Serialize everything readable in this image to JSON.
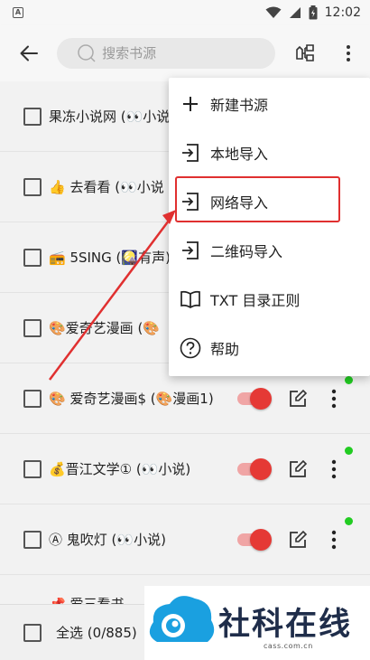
{
  "status_bar": {
    "notification_letter": "A",
    "time": "12:02",
    "icons": [
      "wifi-icon",
      "signal-icon",
      "battery-icon"
    ]
  },
  "toolbar": {
    "back_icon": "arrow-left-icon",
    "search_placeholder": "搜索书源",
    "group_icon": "group-icon",
    "more_icon": "more-vert-icon"
  },
  "list": {
    "items": [
      {
        "name": "果冻小说网 (👀小说"
      },
      {
        "name": "👍 去看看 (👀小说"
      },
      {
        "name": "📻 5SING (🎑有声)"
      },
      {
        "name": "🎨爱奇艺漫画 (🎨"
      },
      {
        "name": "🎨 爱奇艺漫画$ (🎨漫画1)",
        "enabled": true,
        "updated": true
      },
      {
        "name": "💰晋江文学① (👀小说)",
        "enabled": true,
        "updated": true
      },
      {
        "name": "Ⓐ 鬼吹灯 (👀小说)",
        "enabled": true,
        "updated": true
      }
    ],
    "peek_text": "📌 爱三看书"
  },
  "bottom_bar": {
    "select_all_label": "全选",
    "count_text": "(0/885)"
  },
  "menu": {
    "items": [
      {
        "label": "新建书源",
        "icon": "plus-icon"
      },
      {
        "label": "本地导入",
        "icon": "import-icon"
      },
      {
        "label": "网络导入",
        "icon": "import-icon"
      },
      {
        "label": "二维码导入",
        "icon": "import-icon"
      },
      {
        "label": "TXT 目录正则",
        "icon": "book-open-icon"
      },
      {
        "label": "帮助",
        "icon": "help-icon"
      }
    ],
    "highlighted": "网络导入"
  },
  "watermark": {
    "text": "社科在线",
    "sub": "cass.com.cn"
  },
  "colors": {
    "accent_red": "#e53935",
    "switch_track": "#f0a5a5",
    "update_dot": "#22cc22",
    "highlight": "#e03030",
    "watermark_blue": "#1aa0e0",
    "watermark_text": "#1f2d4a"
  }
}
